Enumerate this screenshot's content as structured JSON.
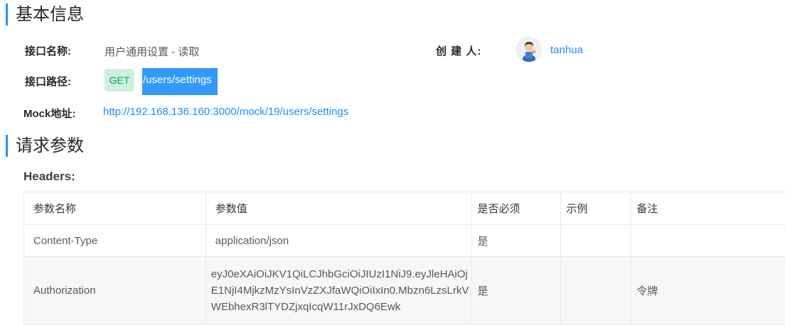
{
  "basic": {
    "title": "基本信息",
    "name_label": "接口名称:",
    "name_value": "用户通用设置 - 读取",
    "creator_label": "创 建 人:",
    "creator_name": "tanhua",
    "path_label": "接口路径:",
    "method": "GET",
    "path": "/users/settings",
    "mock_label": "Mock地址:",
    "mock_url": "http://192.168.136.160:3000/mock/19/users/settings"
  },
  "request": {
    "title": "请求参数",
    "headers_label": "Headers:",
    "columns": [
      "参数名称",
      "参数值",
      "是否必须",
      "示例",
      "备注"
    ],
    "rows": [
      {
        "name": "Content-Type",
        "value": "application/json",
        "required": "是",
        "example": "",
        "note": ""
      },
      {
        "name": "Authorization",
        "value": "eyJ0eXAiOiJKV1QiLCJhbGciOiJIUzI1NiJ9.eyJleHAiOjE1NjI4MjkzMzYsInVzZXJfaWQiOiIxIn0.Mbzn6LzsLrkVWEbhexR3lTYDZjxqIcqW11rJxDQ6Ewk",
        "required": "是",
        "example": "",
        "note": "令牌"
      }
    ]
  },
  "colors": {
    "accent": "#2395f1",
    "link": "#1890ff",
    "get_bg": "#cfefdf",
    "get_text": "#00a854",
    "selection": "#3399ff"
  },
  "icons": {
    "avatar": "user-avatar-icon"
  }
}
